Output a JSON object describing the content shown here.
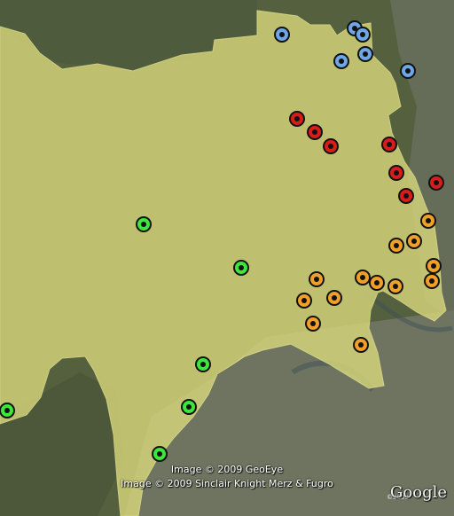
{
  "map": {
    "region_fill": "#d6d67a",
    "region_opacity": 0.82,
    "marker_colors": {
      "blue": "#6ea6e6",
      "red": "#d81c1c",
      "orange": "#f0a028",
      "green": "#3ce63c"
    },
    "markers": [
      {
        "group": "blue",
        "name": "blue-marker"
      },
      {
        "group": "blue",
        "name": "blue-marker"
      },
      {
        "group": "blue",
        "name": "blue-marker"
      },
      {
        "group": "blue",
        "name": "blue-marker"
      },
      {
        "group": "blue",
        "name": "blue-marker"
      },
      {
        "group": "blue",
        "name": "blue-marker"
      },
      {
        "group": "red",
        "name": "red-marker"
      },
      {
        "group": "red",
        "name": "red-marker"
      },
      {
        "group": "red",
        "name": "red-marker"
      },
      {
        "group": "red",
        "name": "red-marker"
      },
      {
        "group": "red",
        "name": "red-marker"
      },
      {
        "group": "red",
        "name": "red-marker"
      },
      {
        "group": "red",
        "name": "red-marker"
      },
      {
        "group": "orange",
        "name": "orange-marker"
      },
      {
        "group": "orange",
        "name": "orange-marker"
      },
      {
        "group": "orange",
        "name": "orange-marker"
      },
      {
        "group": "orange",
        "name": "orange-marker"
      },
      {
        "group": "orange",
        "name": "orange-marker"
      },
      {
        "group": "orange",
        "name": "orange-marker"
      },
      {
        "group": "orange",
        "name": "orange-marker"
      },
      {
        "group": "orange",
        "name": "orange-marker"
      },
      {
        "group": "orange",
        "name": "orange-marker"
      },
      {
        "group": "orange",
        "name": "orange-marker"
      },
      {
        "group": "orange",
        "name": "orange-marker"
      },
      {
        "group": "orange",
        "name": "orange-marker"
      },
      {
        "group": "orange",
        "name": "orange-marker"
      },
      {
        "group": "green",
        "name": "green-marker"
      },
      {
        "group": "green",
        "name": "green-marker"
      },
      {
        "group": "green",
        "name": "green-marker"
      },
      {
        "group": "green",
        "name": "green-marker"
      },
      {
        "group": "green",
        "name": "green-marker"
      },
      {
        "group": "green",
        "name": "green-marker"
      }
    ]
  },
  "credits": {
    "line1": "Image © 2009 GeoEye",
    "line2": "Image © 2009 Sinclair Knight Merz & Fugro"
  },
  "branding": {
    "logo_text": "Google",
    "small_text": "©2009"
  }
}
